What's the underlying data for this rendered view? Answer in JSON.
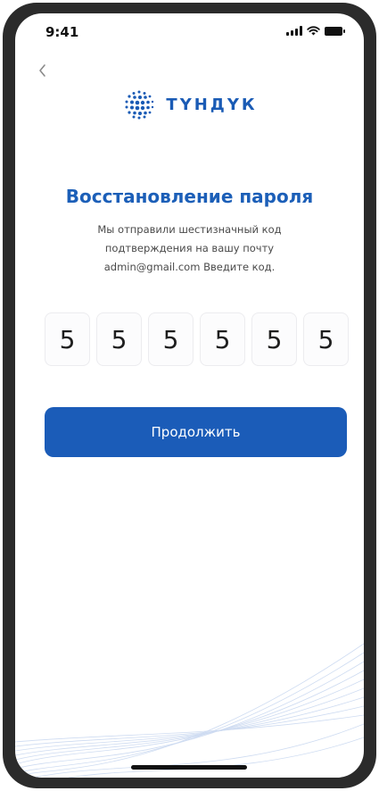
{
  "status_bar": {
    "time": "9:41"
  },
  "logo": {
    "text": "ТҮНДҮК",
    "icon": "globe-icon"
  },
  "header": {
    "back_icon": "chevron-left-icon"
  },
  "title": "Восстановление пароля",
  "description": {
    "line1": "Мы отправили шестизначный код",
    "line2": "подтверждения на вашу почту",
    "line3": "admin@gmail.com  Введите код."
  },
  "code": {
    "digits": [
      "5",
      "5",
      "5",
      "5",
      "5",
      "5"
    ]
  },
  "continue_button": {
    "label": "Продолжить"
  },
  "colors": {
    "accent": "#1b5cb8",
    "title": "#1c5fb8",
    "text": "#4a4a4a"
  }
}
